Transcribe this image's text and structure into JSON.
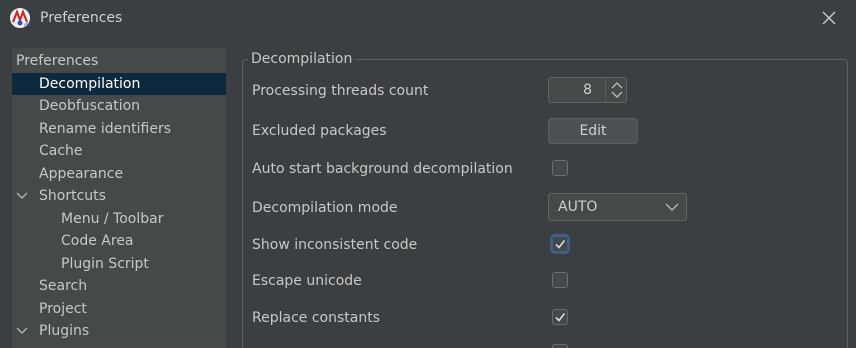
{
  "window": {
    "title": "Preferences",
    "app_icon": "jadx-logo-icon",
    "close_icon": "close-icon"
  },
  "tree": {
    "items": [
      {
        "label": "Preferences",
        "level": 0,
        "expandable": false,
        "selected": false
      },
      {
        "label": "Decompilation",
        "level": 1,
        "expandable": false,
        "selected": true
      },
      {
        "label": "Deobfuscation",
        "level": 1,
        "expandable": false,
        "selected": false
      },
      {
        "label": "Rename identifiers",
        "level": 1,
        "expandable": false,
        "selected": false
      },
      {
        "label": "Cache",
        "level": 1,
        "expandable": false,
        "selected": false
      },
      {
        "label": "Appearance",
        "level": 1,
        "expandable": false,
        "selected": false
      },
      {
        "label": "Shortcuts",
        "level": 1,
        "expandable": true,
        "selected": false
      },
      {
        "label": "Menu / Toolbar",
        "level": 2,
        "expandable": false,
        "selected": false
      },
      {
        "label": "Code Area",
        "level": 2,
        "expandable": false,
        "selected": false
      },
      {
        "label": "Plugin Script",
        "level": 2,
        "expandable": false,
        "selected": false
      },
      {
        "label": "Search",
        "level": 1,
        "expandable": false,
        "selected": false
      },
      {
        "label": "Project",
        "level": 1,
        "expandable": false,
        "selected": false
      },
      {
        "label": "Plugins",
        "level": 1,
        "expandable": true,
        "selected": false
      }
    ]
  },
  "panel": {
    "title": "Decompilation",
    "threads": {
      "label": "Processing threads count",
      "value": "8"
    },
    "excluded": {
      "label": "Excluded packages",
      "button": "Edit"
    },
    "auto_start": {
      "label": "Auto start background decompilation",
      "checked": false
    },
    "mode": {
      "label": "Decompilation mode",
      "value": "AUTO"
    },
    "inconsistent": {
      "label": "Show inconsistent code",
      "checked": true
    },
    "escape_unicode": {
      "label": "Escape unicode",
      "checked": false
    },
    "replace_constants": {
      "label": "Replace constants",
      "checked": true
    }
  },
  "colors": {
    "background": "#3c3f41",
    "tree_background": "#45494a",
    "selection": "#0d293e",
    "focus_ring": "#3d6185"
  }
}
